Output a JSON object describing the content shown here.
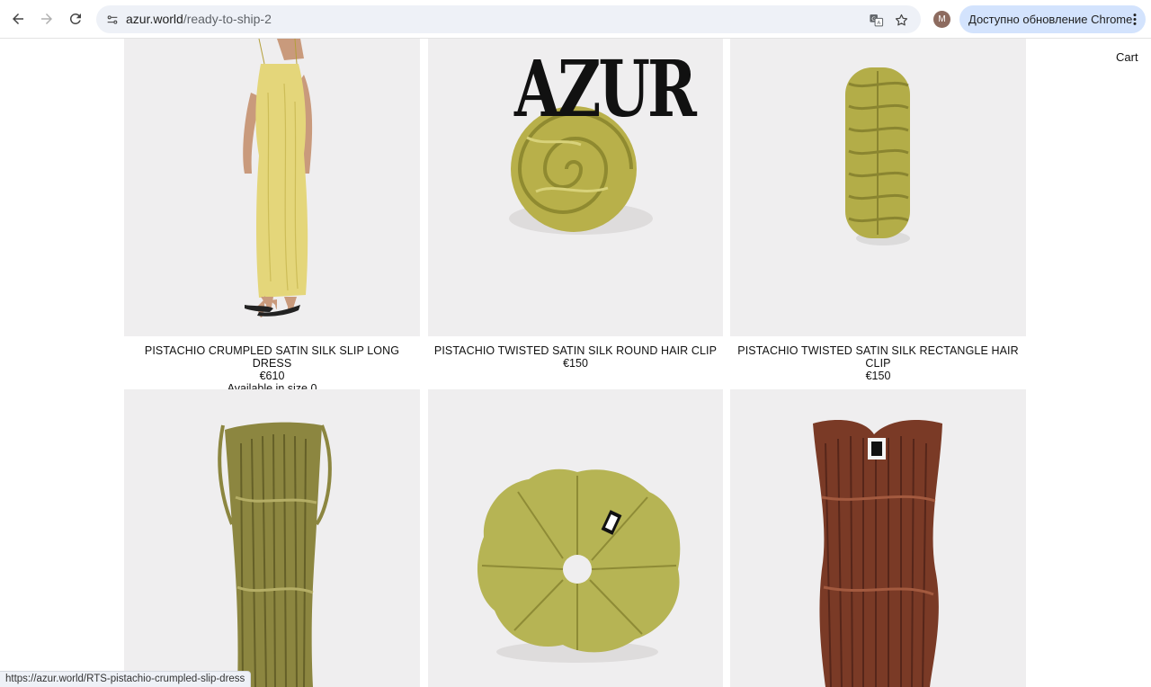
{
  "browser": {
    "url_host": "azur.world",
    "url_path": "/ready-to-ship-2",
    "profile_initial": "M",
    "update_label": "Доступно обновление Chrome",
    "status_url": "https://azur.world/RTS-pistachio-crumpled-slip-dress",
    "icons": [
      "back-arrow-icon",
      "forward-arrow-icon",
      "reload-icon",
      "site-settings-icon",
      "translate-icon",
      "bookmark-star-icon",
      "more-vert-icon"
    ]
  },
  "page": {
    "cart_label": "Cart",
    "logo_text": "AZUR",
    "products": [
      {
        "name": "PISTACHIO CRUMPLED SATIN SILK SLIP LONG DRESS",
        "price": "€610",
        "availability": "Available in size 0"
      },
      {
        "name": "PISTACHIO TWISTED SATIN SILK ROUND HAIR CLIP",
        "price": "€150"
      },
      {
        "name": "PISTACHIO TWISTED SATIN SILK RECTANGLE HAIR CLIP",
        "price": "€150"
      },
      {
        "image": "olive-pleated-dress"
      },
      {
        "image": "pistachio-scrunchie"
      },
      {
        "image": "brown-pleated-top"
      }
    ]
  },
  "colors": {
    "card_bg": "#efeeef",
    "pistachio": "#b8b04a",
    "yellow_dress": "#e4d67a",
    "olive": "#8c8640",
    "brown": "#7a3a26",
    "update_btn": "#d3e3fd"
  }
}
